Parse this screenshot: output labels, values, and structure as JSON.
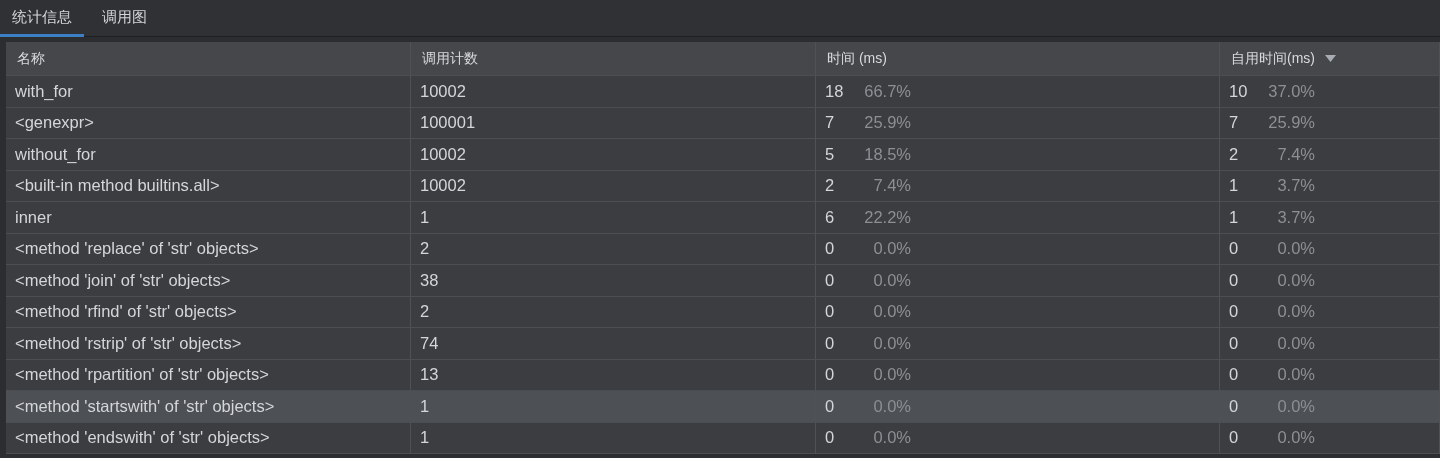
{
  "tabs": [
    {
      "label": "统计信息",
      "selected": true
    },
    {
      "label": "调用图",
      "selected": false
    }
  ],
  "table": {
    "columns": [
      {
        "label": "名称",
        "sorted": false
      },
      {
        "label": "调用计数",
        "sorted": false
      },
      {
        "label": "时间 (ms)",
        "sorted": false
      },
      {
        "label": "自用时间(ms)",
        "sorted": true
      }
    ],
    "rows": [
      {
        "name": "with_for",
        "calls": "10002",
        "time": "18",
        "time_pct": "66.7%",
        "own": "10",
        "own_pct": "37.0%",
        "selected": false
      },
      {
        "name": "<genexpr>",
        "calls": "100001",
        "time": "7",
        "time_pct": "25.9%",
        "own": "7",
        "own_pct": "25.9%",
        "selected": false
      },
      {
        "name": "without_for",
        "calls": "10002",
        "time": "5",
        "time_pct": "18.5%",
        "own": "2",
        "own_pct": "7.4%",
        "selected": false
      },
      {
        "name": "<built-in method builtins.all>",
        "calls": "10002",
        "time": "2",
        "time_pct": "7.4%",
        "own": "1",
        "own_pct": "3.7%",
        "selected": false
      },
      {
        "name": "inner",
        "calls": "1",
        "time": "6",
        "time_pct": "22.2%",
        "own": "1",
        "own_pct": "3.7%",
        "selected": false
      },
      {
        "name": "<method 'replace' of 'str' objects>",
        "calls": "2",
        "time": "0",
        "time_pct": "0.0%",
        "own": "0",
        "own_pct": "0.0%",
        "selected": false
      },
      {
        "name": "<method 'join' of 'str' objects>",
        "calls": "38",
        "time": "0",
        "time_pct": "0.0%",
        "own": "0",
        "own_pct": "0.0%",
        "selected": false
      },
      {
        "name": "<method 'rfind' of 'str' objects>",
        "calls": "2",
        "time": "0",
        "time_pct": "0.0%",
        "own": "0",
        "own_pct": "0.0%",
        "selected": false
      },
      {
        "name": "<method 'rstrip' of 'str' objects>",
        "calls": "74",
        "time": "0",
        "time_pct": "0.0%",
        "own": "0",
        "own_pct": "0.0%",
        "selected": false
      },
      {
        "name": "<method 'rpartition' of 'str' objects>",
        "calls": "13",
        "time": "0",
        "time_pct": "0.0%",
        "own": "0",
        "own_pct": "0.0%",
        "selected": false
      },
      {
        "name": "<method 'startswith' of 'str' objects>",
        "calls": "1",
        "time": "0",
        "time_pct": "0.0%",
        "own": "0",
        "own_pct": "0.0%",
        "selected": true
      },
      {
        "name": "<method 'endswith' of 'str' objects>",
        "calls": "1",
        "time": "0",
        "time_pct": "0.0%",
        "own": "0",
        "own_pct": "0.0%",
        "selected": false
      }
    ]
  }
}
